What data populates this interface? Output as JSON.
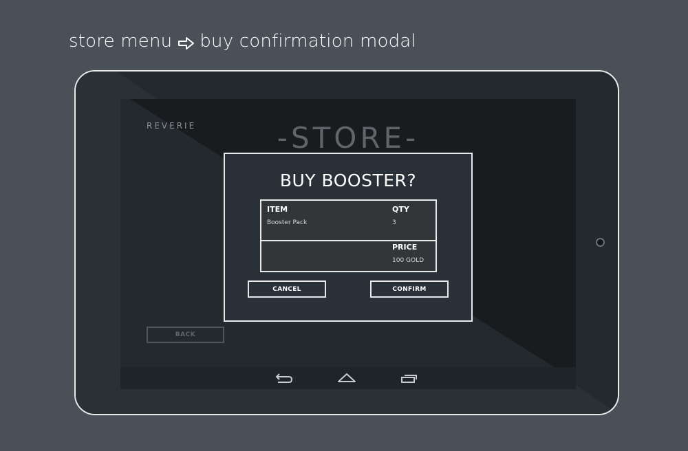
{
  "caption": {
    "from": "store menu",
    "to": "buy confirmation modal",
    "arrow_icon": "outline-right-arrow-icon"
  },
  "screen": {
    "brand": "REVERIE",
    "title": "-STORE-",
    "back_label": "BACK"
  },
  "modal": {
    "title": "BUY BOOSTER?",
    "item_header": "ITEM",
    "item_value": "Booster Pack",
    "qty_header": "QTY",
    "qty_value": "3",
    "price_header": "PRICE",
    "price_value": "100 GOLD",
    "cancel_label": "CANCEL",
    "confirm_label": "CONFIRM"
  },
  "navbar": {
    "icons": [
      "back-icon",
      "home-icon",
      "recent-apps-icon"
    ]
  },
  "colors": {
    "background": "#4a5058",
    "tablet_bezel": "#24292e",
    "screen": "#191c1f",
    "modal": "#2a3038",
    "border": "#e8eaec"
  }
}
